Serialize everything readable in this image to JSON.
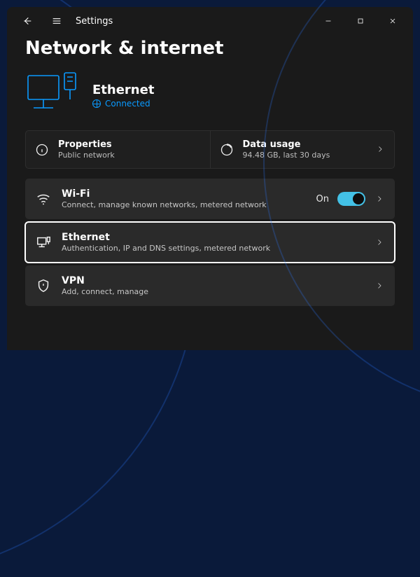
{
  "app_title": "Settings",
  "page_title": "Network & internet",
  "hero": {
    "heading": "Ethernet",
    "status": "Connected"
  },
  "tiles": {
    "properties": {
      "title": "Properties",
      "sub": "Public network"
    },
    "datausage": {
      "title": "Data usage",
      "sub": "94.48 GB, last 30 days"
    }
  },
  "rows": {
    "wifi": {
      "title": "Wi-Fi",
      "sub": "Connect, manage known networks, metered network",
      "state_label": "On"
    },
    "ethernet": {
      "title": "Ethernet",
      "sub": "Authentication, IP and DNS settings, metered network"
    },
    "vpn": {
      "title": "VPN",
      "sub": "Add, connect, manage"
    }
  }
}
